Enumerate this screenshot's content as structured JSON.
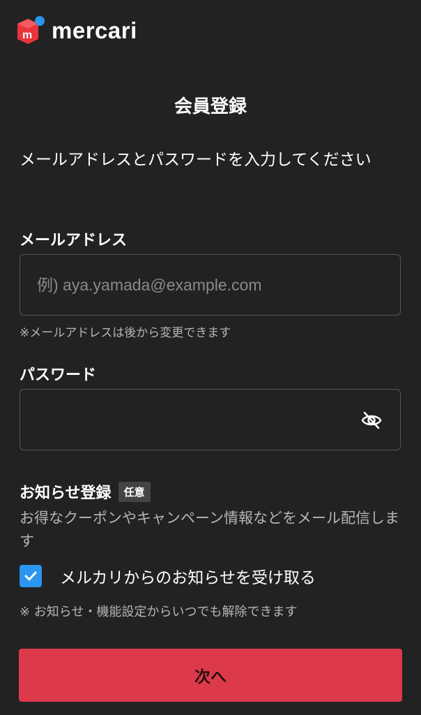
{
  "header": {
    "logo_text": "mercari",
    "logo_icon": "mercari-box-icon",
    "logo_color": "#e8333a",
    "logo_dot_color": "#2b95f0"
  },
  "page": {
    "title": "会員登録",
    "instructions": "メールアドレスとパスワードを入力してください"
  },
  "email": {
    "label": "メールアドレス",
    "placeholder": "例) aya.yamada@example.com",
    "value": "",
    "hint": "※メールアドレスは後から変更できます"
  },
  "password": {
    "label": "パスワード",
    "value": "",
    "visibility_icon": "eye-slash-icon"
  },
  "newsletter": {
    "title": "お知らせ登録",
    "badge": "任意",
    "description": "お得なクーポンやキャンペーン情報などをメール配信します",
    "checkbox_label": "メルカリからのお知らせを受け取る",
    "checked": true,
    "checkbox_color": "#2b95f0",
    "note": "※ お知らせ・機能設定からいつでも解除できます"
  },
  "actions": {
    "next_label": "次へ",
    "next_color": "#dc3a4b"
  },
  "theme": {
    "background": "#222222",
    "text_primary": "#ffffff",
    "text_secondary": "#b5b5b5",
    "border": "#555555"
  }
}
